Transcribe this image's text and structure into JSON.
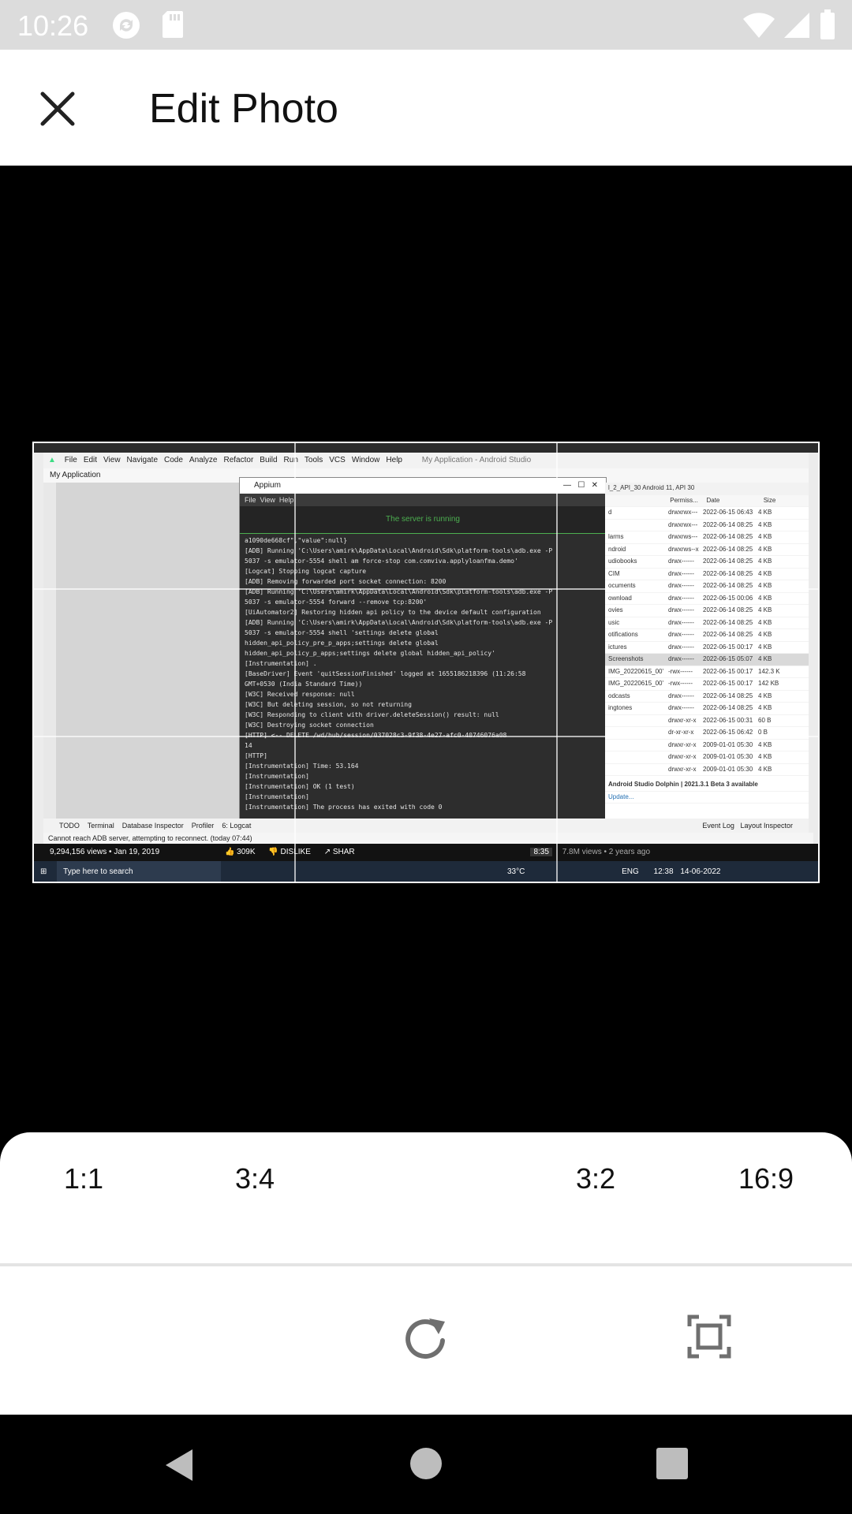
{
  "status_bar": {
    "time": "10:26",
    "icons": [
      "sync-icon",
      "sd-card-icon",
      "wifi-icon",
      "cellular-icon",
      "battery-icon"
    ]
  },
  "app_bar": {
    "title": "Edit Photo",
    "close_icon": "close-icon"
  },
  "image": {
    "description_type": "screenshot",
    "ide_window_title": "My Application - Android Studio",
    "menu": [
      "File",
      "Edit",
      "View",
      "Navigate",
      "Code",
      "Analyze",
      "Refactor",
      "Build",
      "Run",
      "Tools",
      "VCS",
      "Window",
      "Help"
    ],
    "project_name": "My Application",
    "appium": {
      "title": "Appium",
      "menu": [
        "File",
        "View",
        "Help"
      ],
      "status": "The server is running",
      "log": [
        "a1090de668cf\",\"value\":null}",
        "[ADB] Running 'C:\\Users\\amirk\\AppData\\Local\\Android\\Sdk\\platform-tools\\adb.exe -P",
        "5037 -s emulator-5554 shell am force-stop com.comviva.applyloanfma.demo'",
        "[Logcat] Stopping logcat capture",
        "[ADB] Removing forwarded port socket connection: 8200",
        "[ADB] Running 'C:\\Users\\amirk\\AppData\\Local\\Android\\Sdk\\platform-tools\\adb.exe -P",
        "5037 -s emulator-5554 forward --remove tcp:8200'",
        "[UiAutomator2] Restoring hidden api policy to the device default configuration",
        "[ADB] Running 'C:\\Users\\amirk\\AppData\\Local\\Android\\Sdk\\platform-tools\\adb.exe -P",
        "5037 -s emulator-5554 shell 'settings delete global",
        "hidden_api_policy_pre_p_apps;settings delete global",
        "hidden_api_policy_p_apps;settings delete global hidden_api_policy'",
        "[Instrumentation] .",
        "[BaseDriver] Event 'quitSessionFinished' logged at 1655186218396 (11:26:58",
        "GMT+0530 (India Standard Time))",
        "[W3C] Received response: null",
        "[W3C] But deleting session, so not returning",
        "[W3C] Responding to client with driver.deleteSession() result: null",
        "[W3C] Destroying socket connection",
        "[HTTP] <-- DELETE /wd/hub/session/037028c3-9f38-4e27-afc0-40746076a08",
        "14",
        "[HTTP]",
        "[Instrumentation] Time: 53.164",
        "[Instrumentation]",
        "[Instrumentation] OK (1 test)",
        "[Instrumentation]",
        "[Instrumentation] The process has exited with code 0"
      ]
    },
    "device_file_explorer": {
      "device": "l_2_API_30 Android 11, API 30",
      "columns": [
        "Permiss...",
        "Date",
        "Size"
      ],
      "rows": [
        {
          "name": "d",
          "perm": "drwxrwx---",
          "date": "2022-06-15 06:43",
          "size": "4 KB"
        },
        {
          "name": "",
          "perm": "drwxrwx---",
          "date": "2022-06-14 08:25",
          "size": "4 KB"
        },
        {
          "name": "larms",
          "perm": "drwxrws---",
          "date": "2022-06-14 08:25",
          "size": "4 KB"
        },
        {
          "name": "ndroid",
          "perm": "drwxrws--x",
          "date": "2022-06-14 08:25",
          "size": "4 KB"
        },
        {
          "name": "udiobooks",
          "perm": "drwx------",
          "date": "2022-06-14 08:25",
          "size": "4 KB"
        },
        {
          "name": "CIM",
          "perm": "drwx------",
          "date": "2022-06-14 08:25",
          "size": "4 KB"
        },
        {
          "name": "ocuments",
          "perm": "drwx------",
          "date": "2022-06-14 08:25",
          "size": "4 KB"
        },
        {
          "name": "ownload",
          "perm": "drwx------",
          "date": "2022-06-15 00:06",
          "size": "4 KB"
        },
        {
          "name": "ovies",
          "perm": "drwx------",
          "date": "2022-06-14 08:25",
          "size": "4 KB"
        },
        {
          "name": "usic",
          "perm": "drwx------",
          "date": "2022-06-14 08:25",
          "size": "4 KB"
        },
        {
          "name": "otifications",
          "perm": "drwx------",
          "date": "2022-06-14 08:25",
          "size": "4 KB"
        },
        {
          "name": "ictures",
          "perm": "drwx------",
          "date": "2022-06-15 00:17",
          "size": "4 KB"
        },
        {
          "name": "Screenshots",
          "perm": "drwx------",
          "date": "2022-06-15 05:07",
          "size": "4 KB"
        },
        {
          "name": "IMG_20220615_00'",
          "perm": "-rwx------",
          "date": "2022-06-15 00:17",
          "size": "142.3 K"
        },
        {
          "name": "IMG_20220615_00'",
          "perm": "-rwx------",
          "date": "2022-06-15 00:17",
          "size": "142 KB"
        },
        {
          "name": "odcasts",
          "perm": "drwx------",
          "date": "2022-06-14 08:25",
          "size": "4 KB"
        },
        {
          "name": "ingtones",
          "perm": "drwx------",
          "date": "2022-06-14 08:25",
          "size": "4 KB"
        },
        {
          "name": "",
          "perm": "drwxr-xr-x",
          "date": "2022-06-15 00:31",
          "size": "60 B"
        },
        {
          "name": "",
          "perm": "dr-xr-xr-x",
          "date": "2022-06-15 06:42",
          "size": "0 B"
        },
        {
          "name": "",
          "perm": "drwxr-xr-x",
          "date": "2009-01-01 05:30",
          "size": "4 KB"
        },
        {
          "name": "",
          "perm": "drwxr-xr-x",
          "date": "2009-01-01 05:30",
          "size": "4 KB"
        },
        {
          "name": "",
          "perm": "drwxr-xr-x",
          "date": "2009-01-01 05:30",
          "size": "4 KB"
        }
      ],
      "update_notice": "Android Studio Dolphin | 2021.3.1 Beta 3 available",
      "update_link": "Update..."
    },
    "bottom_tools": [
      "TODO",
      "Terminal",
      "Database Inspector",
      "Profiler",
      "6: Logcat",
      "Event Log",
      "Layout Inspector"
    ],
    "status_message": "Cannot reach ADB server, attempting to reconnect. (today 07:44)",
    "youtube": {
      "views": "9,294,156 views • Jan 19, 2019",
      "likes": "309K",
      "dislike": "DISLIKE",
      "share": "SHAR",
      "duration": "8:35",
      "meta": "7.8M views • 2 years ago"
    },
    "taskbar": {
      "search_placeholder": "Type here to search",
      "weather": "33°C",
      "lang": "ENG",
      "time": "12:38",
      "date": "14-06-2022"
    }
  },
  "aspect_ratios": [
    "1:1",
    "3:4",
    "3:2",
    "16:9"
  ],
  "tools": {
    "rotate": "rotate-icon",
    "crop_fit": "fit-screen-icon"
  },
  "nav": [
    "back-icon",
    "home-icon",
    "recents-icon"
  ]
}
